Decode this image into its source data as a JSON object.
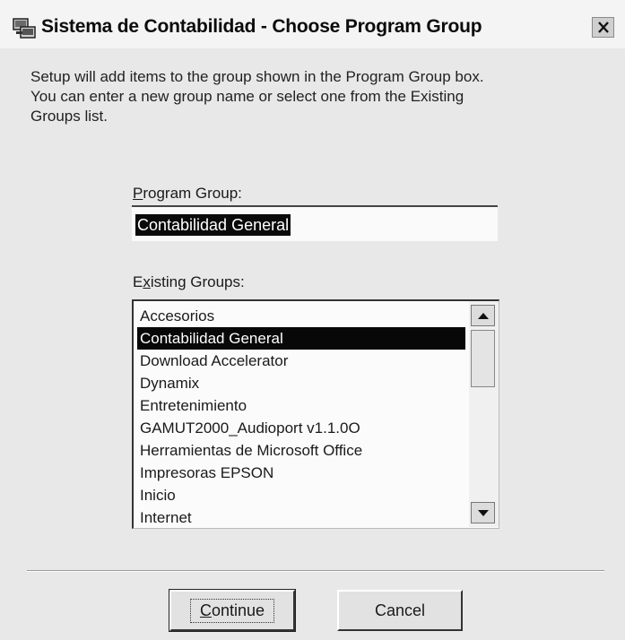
{
  "window": {
    "title": "Sistema de Contabilidad - Choose Program Group",
    "close_glyph": "✕",
    "app_icon": "program-group-icon"
  },
  "description": {
    "line1": "Setup will add items to the group shown in the Program Group box.",
    "line2": "You can enter a new group name or select one from the Existing",
    "line3": "Groups list."
  },
  "program_group": {
    "label_accel": "P",
    "label_rest": "rogram Group:",
    "value": "Contabilidad General"
  },
  "existing_groups": {
    "label_pre": "E",
    "label_accel": "x",
    "label_rest": "isting Groups:",
    "items": [
      "Accesorios",
      "Contabilidad General",
      "Download Accelerator",
      "Dynamix",
      "Entretenimiento",
      "GAMUT2000_Audioport v1.1.0O",
      "Herramientas de Microsoft Office",
      "Impresoras EPSON",
      "Inicio",
      "Internet"
    ],
    "selected_index": 1
  },
  "buttons": {
    "continue_accel": "C",
    "continue_rest": "ontinue",
    "cancel_label": "Cancel"
  },
  "colors": {
    "selection": "#080808",
    "window_bg": "#e8e8e8"
  }
}
